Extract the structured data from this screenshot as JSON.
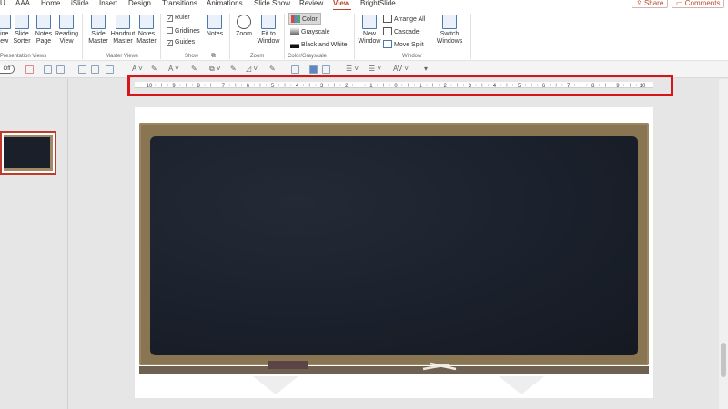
{
  "tabs": [
    {
      "label": "U"
    },
    {
      "label": "AAA"
    },
    {
      "label": "Home"
    },
    {
      "label": "iSlide"
    },
    {
      "label": "Insert"
    },
    {
      "label": "Design"
    },
    {
      "label": "Transitions"
    },
    {
      "label": "Animations"
    },
    {
      "label": "Slide Show"
    },
    {
      "label": "Review"
    },
    {
      "label": "View"
    },
    {
      "label": "BrightSlide"
    }
  ],
  "active_tab": "View",
  "top_right": {
    "share": "Share",
    "comments": "Comments"
  },
  "ribbon": {
    "presentation_views": {
      "label": "Presentation Views",
      "buttons": [
        {
          "label": "line\nlew"
        },
        {
          "label": "Slide\nSorter"
        },
        {
          "label": "Notes\nPage"
        },
        {
          "label": "Reading\nView"
        }
      ]
    },
    "master_views": {
      "label": "Master Views",
      "buttons": [
        {
          "label": "Slide\nMaster"
        },
        {
          "label": "Handout\nMaster"
        },
        {
          "label": "Notes\nMaster"
        }
      ]
    },
    "show": {
      "label": "Show",
      "checks": [
        {
          "label": "Ruler",
          "checked": true
        },
        {
          "label": "Gridlines",
          "checked": false
        },
        {
          "label": "Guides",
          "checked": true
        }
      ],
      "notes": "Notes"
    },
    "zoom": {
      "label": "Zoom",
      "buttons": [
        {
          "label": "Zoom"
        },
        {
          "label": "Fit to\nWindow"
        }
      ]
    },
    "color": {
      "label": "Color/Grayscale",
      "items": [
        {
          "label": "Color"
        },
        {
          "label": "Grayscale"
        },
        {
          "label": "Black and White"
        }
      ]
    },
    "window": {
      "label": "Window",
      "new_window": "New\nWindow",
      "items": [
        {
          "label": "Arrange All"
        },
        {
          "label": "Cascade"
        },
        {
          "label": "Move Split"
        }
      ],
      "switch": "Switch\nWindows"
    }
  },
  "toolbar": {
    "toggle": "Off",
    "char_spacing": "AV"
  },
  "ruler": {
    "labels": [
      "10",
      "9",
      "8",
      "7",
      "6",
      "5",
      "4",
      "3",
      "2",
      "1",
      "0",
      "1",
      "2",
      "3",
      "4",
      "5",
      "6",
      "7",
      "8",
      "9",
      "10"
    ]
  },
  "colors": {
    "accent": "#b7472a",
    "highlight": "#d6151b",
    "board": "#1b212c",
    "frame": "#8a7553"
  }
}
